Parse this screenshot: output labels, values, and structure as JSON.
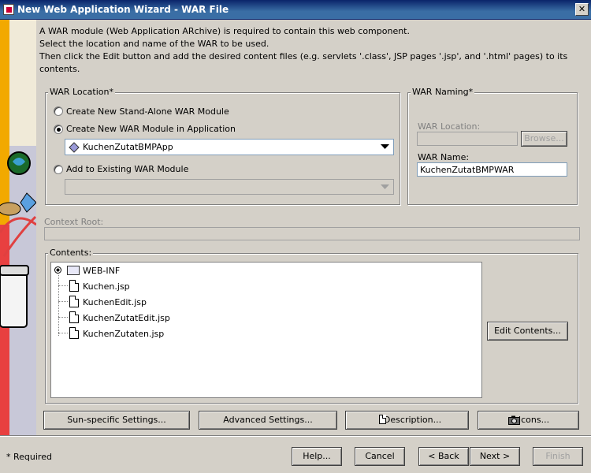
{
  "window": {
    "title": "New Web Application Wizard - WAR File",
    "close": "✕"
  },
  "description": [
    "A WAR module (Web Application ARchive) is required to contain this web component.",
    "Select the location and name of the WAR to be used.",
    "Then click the Edit button and add the desired content files (e.g. servlets '.class', JSP pages '.jsp', and '.html' pages) to its",
    "contents."
  ],
  "war_location": {
    "label": "WAR Location*",
    "opt_standalone": "Create New Stand-Alone WAR Module",
    "opt_in_app": "Create New WAR Module in Application",
    "app_selected": "KuchenZutatBMPApp",
    "opt_existing": "Add to Existing WAR Module",
    "existing_selected": ""
  },
  "war_naming": {
    "label": "WAR Naming*",
    "location_label": "WAR Location:",
    "location_value": "",
    "browse": "Browse...",
    "name_label": "WAR Name:",
    "name_value": "KuchenZutatBMPWAR"
  },
  "context_root": {
    "label": "Context Root:",
    "value": ""
  },
  "contents": {
    "label": "Contents:",
    "root": "WEB-INF",
    "files": [
      "Kuchen.jsp",
      "KuchenEdit.jsp",
      "KuchenZutatEdit.jsp",
      "KuchenZutaten.jsp"
    ],
    "edit_button": "Edit Contents..."
  },
  "settings_buttons": {
    "sun": "Sun-specific Settings...",
    "advanced": "Advanced Settings...",
    "description": "Description...",
    "icons": "Icons..."
  },
  "footer": {
    "required_note": "* Required",
    "help": "Help...",
    "cancel": "Cancel",
    "back": "< Back",
    "next": "Next >",
    "finish": "Finish"
  },
  "colors": {
    "titlebar": "#0a246a",
    "face": "#d4d0c8"
  }
}
